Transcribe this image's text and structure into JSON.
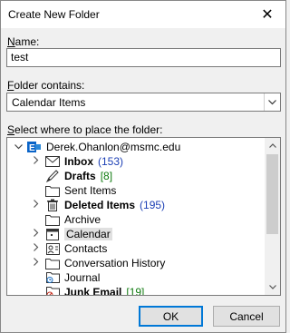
{
  "dialog": {
    "title": "Create New Folder",
    "close_glyph": "✕"
  },
  "name": {
    "label_u": "N",
    "label_rest": "ame:",
    "value": "test"
  },
  "contains": {
    "label_u": "F",
    "label_rest": "older contains:",
    "selected": "Calendar Items"
  },
  "place": {
    "label_u": "S",
    "label_rest": "elect where to place the folder:"
  },
  "tree": {
    "account": "Derek.Ohanlon@msmc.edu",
    "items": [
      {
        "label": "Inbox",
        "count": "(153)",
        "count_color": "#1c3fb5",
        "bold": true,
        "icon": "inbox-icon",
        "expandable": true
      },
      {
        "label": "Drafts",
        "count": "[8]",
        "count_color": "#0f7a0f",
        "bold": true,
        "icon": "drafts-icon",
        "expandable": false
      },
      {
        "label": "Sent Items",
        "count": "",
        "bold": false,
        "icon": "folder-icon",
        "expandable": false
      },
      {
        "label": "Deleted Items",
        "count": "(195)",
        "count_color": "#1c3fb5",
        "bold": true,
        "icon": "trash-icon",
        "expandable": true
      },
      {
        "label": "Archive",
        "count": "",
        "bold": false,
        "icon": "folder-icon",
        "expandable": false
      },
      {
        "label": "Calendar",
        "count": "",
        "bold": false,
        "icon": "calendar-icon",
        "expandable": true,
        "selected": true
      },
      {
        "label": "Contacts",
        "count": "",
        "bold": false,
        "icon": "contacts-icon",
        "expandable": true
      },
      {
        "label": "Conversation History",
        "count": "",
        "bold": false,
        "icon": "folder-icon",
        "expandable": true
      },
      {
        "label": "Journal",
        "count": "",
        "bold": false,
        "icon": "journal-icon",
        "expandable": false
      },
      {
        "label": "Junk Email",
        "count": "[19]",
        "count_color": "#0f7a0f",
        "bold": true,
        "icon": "junk-icon",
        "expandable": false
      }
    ]
  },
  "buttons": {
    "ok": "OK",
    "cancel": "Cancel"
  },
  "colors": {
    "accent": "#0078d7",
    "account_icon": "#0a64c8"
  }
}
